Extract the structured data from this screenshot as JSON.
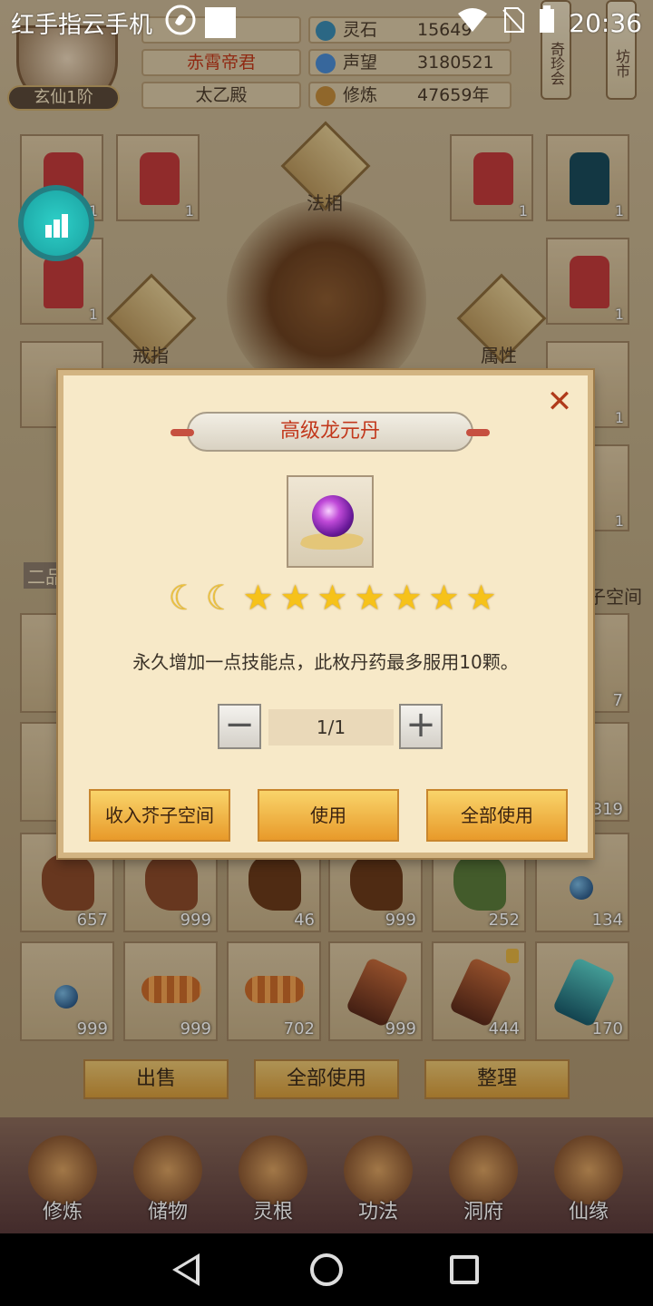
{
  "status_bar": {
    "carrier": "红手指云手机",
    "time": "20:36"
  },
  "header": {
    "rank": "玄仙1阶",
    "names": [
      "",
      "赤霄帝君",
      "太乙殿"
    ],
    "stats": [
      {
        "label": "灵石",
        "value": "15649",
        "icon": "spirit-stone-icon",
        "color": "#3a8ab0"
      },
      {
        "label": "声望",
        "value": "3180521",
        "icon": "reputation-icon",
        "color": "#4a8ad0"
      },
      {
        "label": "修炼",
        "value": "47659年",
        "icon": "cultivation-icon",
        "color": "#c08a3a"
      }
    ],
    "hanging_signs": [
      "奇珍会",
      "坊市"
    ]
  },
  "equipment": {
    "labels": {
      "dharma": "法相",
      "ring": "戒指",
      "attribute": "属性",
      "space": "子空间",
      "grade": "二品"
    },
    "slot_counts": [
      "1",
      "1",
      "1",
      "1",
      "1",
      "1",
      "1",
      "1"
    ]
  },
  "bag": {
    "row1_counts": [
      "657",
      "999",
      "46",
      "999",
      "252",
      "134"
    ],
    "row2_counts": [
      "999",
      "999",
      "702",
      "999",
      "444",
      "170"
    ],
    "side_counts": [
      "7",
      "319"
    ]
  },
  "bottom_buttons": {
    "sell": "出售",
    "use_all": "全部使用",
    "arrange": "整理"
  },
  "nav": {
    "items": [
      "修炼",
      "储物",
      "灵根",
      "功法",
      "洞府",
      "仙缘"
    ]
  },
  "dialog": {
    "title": "高级龙元丹",
    "close": "✕",
    "rating": {
      "moons": 2,
      "stars": 7
    },
    "description": "永久增加一点技能点，此枚丹药最多服用10颗。",
    "quantity": "1/1",
    "minus": "−",
    "plus": "+",
    "buttons": {
      "store": "收入芥子空间",
      "use": "使用",
      "use_all": "全部使用"
    }
  },
  "colors": {
    "dialog_bg": "#f7e9c8",
    "title_text": "#c2381c",
    "button_gold": "#e8a82a",
    "float_button": "#2ec8c0"
  }
}
